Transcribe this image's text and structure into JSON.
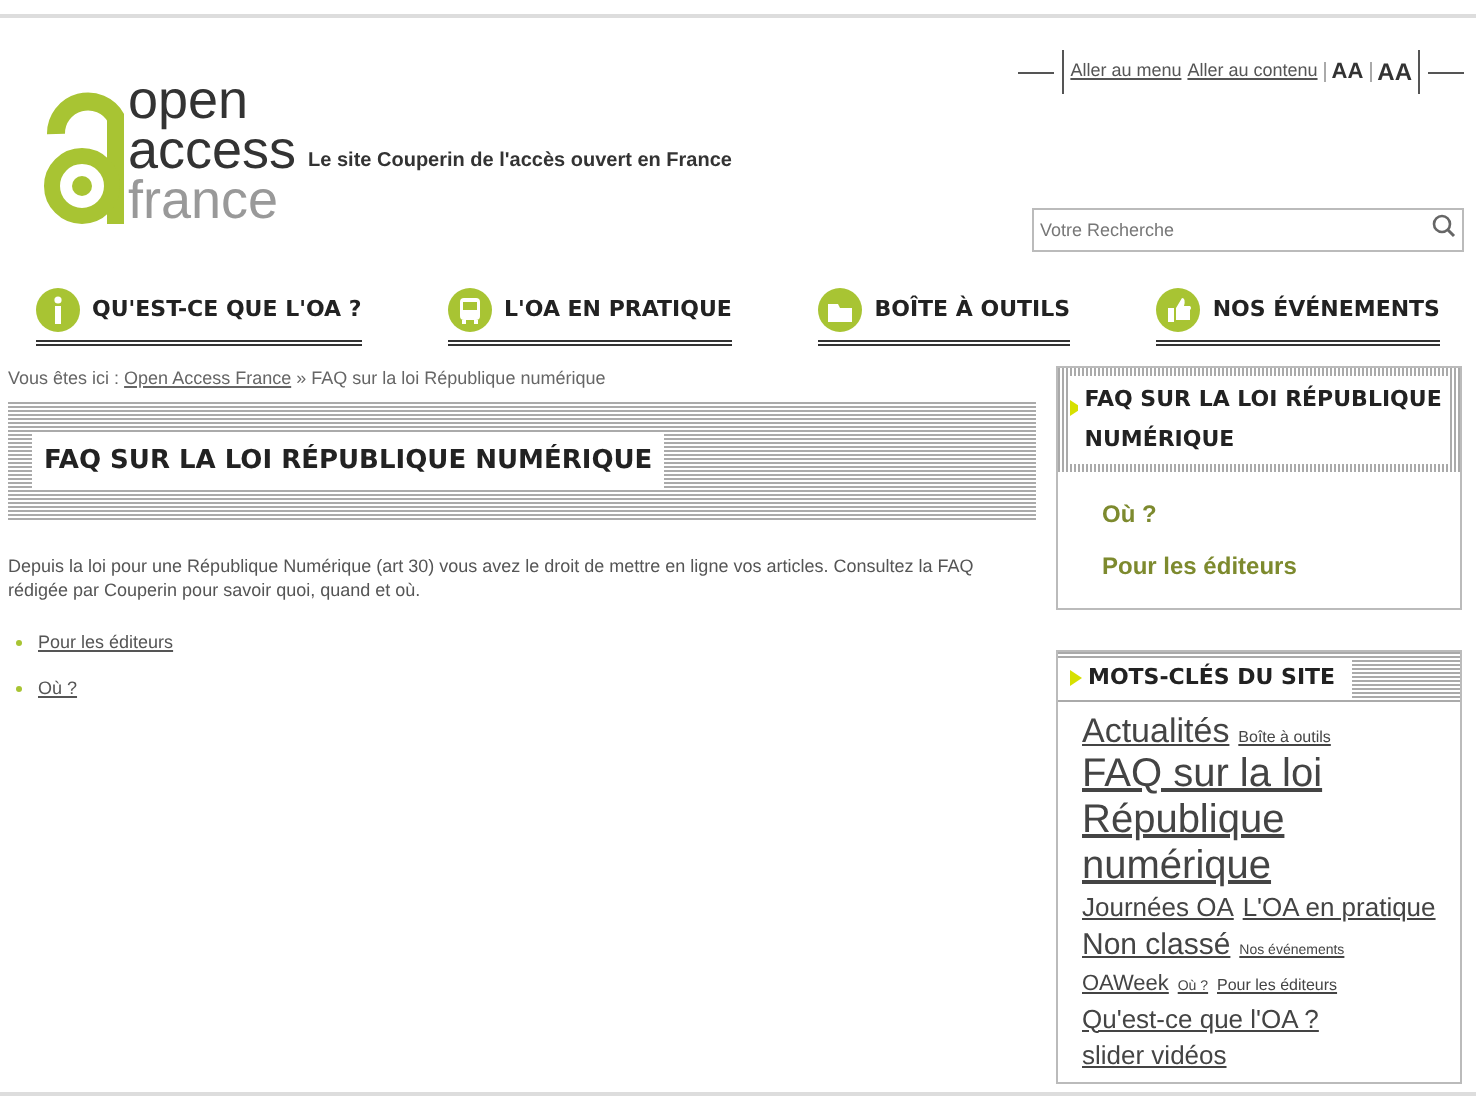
{
  "header": {
    "logo": [
      "open",
      "access",
      "france"
    ],
    "tagline": "Le site Couperin de l'accès ouvert en France",
    "skip_links": [
      "Aller au menu",
      "Aller au contenu"
    ],
    "font_buttons": [
      "AA",
      "AA"
    ],
    "search": {
      "placeholder": "Votre Recherche"
    }
  },
  "nav": [
    {
      "label": "QU'EST-CE QUE L'OA ?",
      "kind": "info"
    },
    {
      "label": "L'OA EN PRATIQUE",
      "kind": "bus"
    },
    {
      "label": "BOÎTE À OUTILS",
      "kind": "folder"
    },
    {
      "label": "NOS ÉVÉNEMENTS",
      "kind": "thumb"
    }
  ],
  "breadcrumb": {
    "prefix": "Vous êtes ici :",
    "link": "Open Access France",
    "separator": "»",
    "current": "FAQ sur la loi République numérique"
  },
  "main": {
    "title": "FAQ SUR LA LOI RÉPUBLIQUE NUMÉRIQUE",
    "intro": "Depuis la loi pour une République Numérique (art 30) vous avez le droit de mettre en ligne vos articles. Consultez la FAQ rédigée par Couperin pour savoir quoi, quand et où.",
    "links": [
      "Pour les éditeurs",
      "Où ?"
    ]
  },
  "sidebar": {
    "menu": {
      "title": "FAQ SUR LA LOI RÉPUBLIQUE NUMÉRIQUE",
      "items": [
        "Où ?",
        "Pour les éditeurs"
      ]
    },
    "tags": {
      "title": "MOTS-CLÉS DU SITE",
      "items": [
        {
          "label": "Actualités",
          "kind": "l"
        },
        {
          "label": "Boîte à outils",
          "kind": "xs"
        },
        {
          "label": "FAQ sur la loi République numérique",
          "kind": "xl"
        },
        {
          "label": "Journées OA",
          "kind": "m"
        },
        {
          "label": "L'OA en pratique",
          "kind": "m"
        },
        {
          "label": "Non classé",
          "kind": "ml"
        },
        {
          "label": "Nos événements",
          "kind": "xxs"
        },
        {
          "label": "OAWeek",
          "kind": "s"
        },
        {
          "label": "Où ?",
          "kind": "xxs"
        },
        {
          "label": "Pour les éditeurs",
          "kind": "xs"
        },
        {
          "label": "Qu'est-ce que l'OA ?",
          "kind": "m"
        },
        {
          "label": "slider vidéos",
          "kind": "m"
        }
      ]
    }
  }
}
